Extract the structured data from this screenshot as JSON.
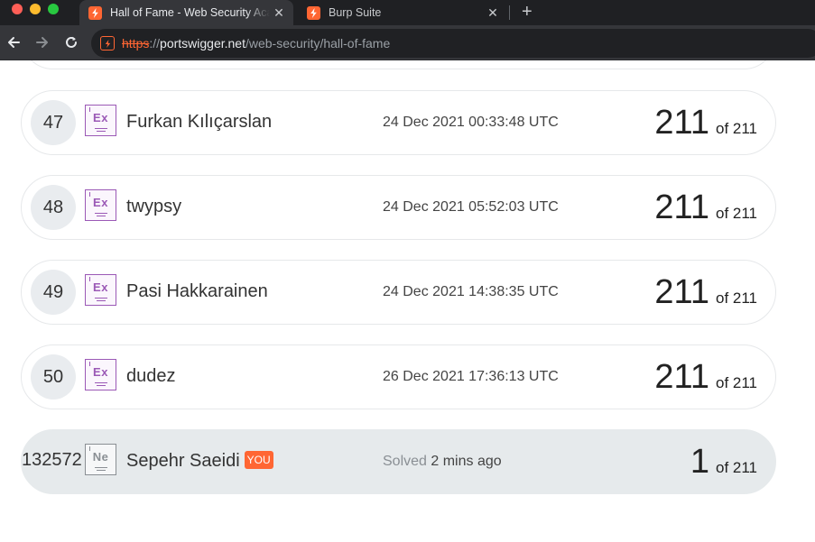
{
  "browser": {
    "tabs": [
      {
        "title": "Hall of Fame - Web Security Academy",
        "active": true
      },
      {
        "title": "Burp Suite",
        "active": false
      }
    ],
    "url": {
      "scheme": "https",
      "separator": "://",
      "host": "portswigger.net",
      "path": "/web-security/hall-of-fame"
    },
    "icons": {
      "back": "arrow-left-icon",
      "forward": "arrow-right-icon",
      "reload": "reload-icon",
      "new_tab": "plus-icon",
      "close": "close-icon"
    },
    "close_glyph": "✕",
    "new_tab_glyph": "+"
  },
  "leaderboard": {
    "rows": [
      {
        "rank": "47",
        "level": "Ex",
        "name": "Furkan Kılıçarslan",
        "date": "24 Dec 2021 00:33:48 UTC",
        "score": "211",
        "total": "of 211"
      },
      {
        "rank": "48",
        "level": "Ex",
        "name": "twypsy",
        "date": "24 Dec 2021 05:52:03 UTC",
        "score": "211",
        "total": "of 211"
      },
      {
        "rank": "49",
        "level": "Ex",
        "name": "Pasi Hakkarainen",
        "date": "24 Dec 2021 14:38:35 UTC",
        "score": "211",
        "total": "of 211"
      },
      {
        "rank": "50",
        "level": "Ex",
        "name": "dudez",
        "date": "26 Dec 2021 17:36:13 UTC",
        "score": "211",
        "total": "of 211"
      }
    ],
    "current_user": {
      "rank": "132572",
      "level": "Ne",
      "name": "Sepehr Saeidi",
      "badge": "YOU",
      "solved_label": "Solved",
      "solved_time": "2 mins ago",
      "score": "1",
      "total": "of 211"
    }
  },
  "colors": {
    "brand": "#ff6633",
    "expert": "#9b59b6",
    "newbie": "#8a8f94",
    "highlight_row": "#e6eaec"
  }
}
